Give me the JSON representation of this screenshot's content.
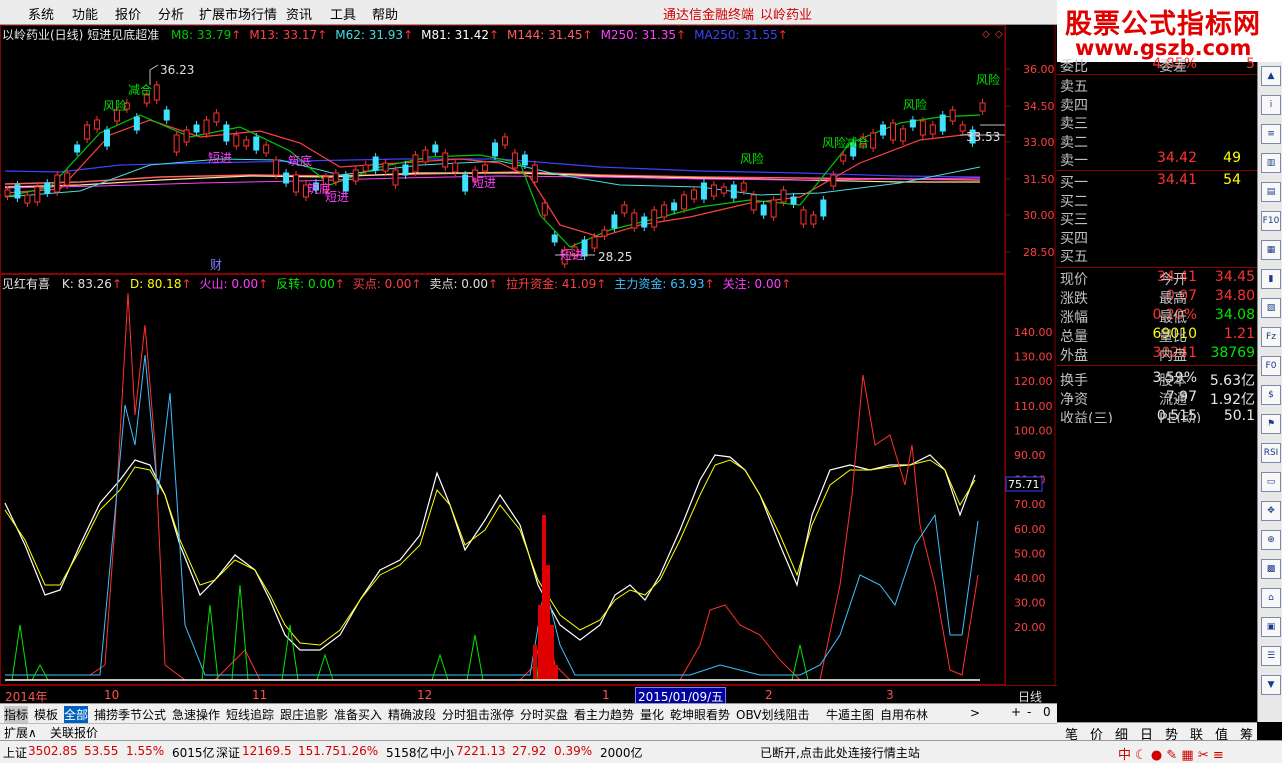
{
  "menu": {
    "items": [
      "系统",
      "功能",
      "报价",
      "分析",
      "扩展市场行情",
      "资讯",
      "工具",
      "帮助"
    ],
    "app_title": "通达信金融终端",
    "stock_title": "以岭药业"
  },
  "logo": {
    "line1": "股票公式指标网",
    "line2": "www.gszb.com"
  },
  "top_legend": {
    "title": "以岭药业(日线)",
    "formula": "短进见底超准",
    "items": [
      {
        "label": "M8: 33.79",
        "color": "#00c800"
      },
      {
        "label": "M13: 33.17",
        "color": "#ff4040"
      },
      {
        "label": "M62: 31.93",
        "color": "#40e0e0"
      },
      {
        "label": "M81: 31.42",
        "color": "#ffffff"
      },
      {
        "label": "M144: 31.45",
        "color": "#ff6060"
      },
      {
        "label": "M250: 31.35",
        "color": "#ff40ff"
      },
      {
        "label": "MA250: 31.55",
        "color": "#4040ff"
      }
    ]
  },
  "price_axis": [
    "36.00",
    "34.50",
    "33.00",
    "31.50",
    "30.00",
    "28.50"
  ],
  "price_annotations": {
    "high": "36.23",
    "low": "28.25",
    "last": "33.53"
  },
  "signals": {
    "risk": "风险",
    "jianhe": "减合",
    "short_entry": "短进",
    "fa": "财",
    "suanzhu": "筑底"
  },
  "bottom_legend": {
    "title": "见红有喜",
    "items": [
      {
        "label": "K: 83.26",
        "color": "#e0e0e0"
      },
      {
        "label": "D: 80.18",
        "color": "#ffff00"
      },
      {
        "label": "火山: 0.00",
        "color": "#ff40ff"
      },
      {
        "label": "反转: 0.00",
        "color": "#00e600"
      },
      {
        "label": "买点: 0.00",
        "color": "#ff4040"
      },
      {
        "label": "卖点: 0.00",
        "color": "#e0e0e0"
      },
      {
        "label": "拉升资金: 41.09",
        "color": "#ff4040"
      },
      {
        "label": "主力资金: 63.93",
        "color": "#40c0ff"
      },
      {
        "label": "关注: 0.00",
        "color": "#ff40ff"
      }
    ]
  },
  "ind_axis": [
    "140.00",
    "130.00",
    "120.00",
    "110.00",
    "100.00",
    "90.00",
    "80.00",
    "70.00",
    "60.00",
    "50.00",
    "40.00",
    "30.00",
    "20.00"
  ],
  "ind_current": "75.71",
  "date_axis": {
    "labels": [
      "2014年",
      "10",
      "11",
      "12",
      "1",
      "2",
      "3"
    ],
    "cursor": "2015/01/09/五",
    "period": "日线"
  },
  "quote": {
    "weibi": {
      "label": "委比",
      "value": "4.85%",
      "label2": "委差",
      "value2": "5"
    },
    "sell": [
      {
        "label": "卖五",
        "price": "",
        "vol": ""
      },
      {
        "label": "卖四",
        "price": "",
        "vol": ""
      },
      {
        "label": "卖三",
        "price": "",
        "vol": ""
      },
      {
        "label": "卖二",
        "price": "",
        "vol": ""
      },
      {
        "label": "卖一",
        "price": "34.42",
        "vol": "49"
      }
    ],
    "buy": [
      {
        "label": "买一",
        "price": "34.41",
        "vol": "54"
      },
      {
        "label": "买二",
        "price": "",
        "vol": ""
      },
      {
        "label": "买三",
        "price": "",
        "vol": ""
      },
      {
        "label": "买四",
        "price": "",
        "vol": ""
      },
      {
        "label": "买五",
        "price": "",
        "vol": ""
      }
    ],
    "stats": [
      {
        "l1": "现价",
        "v1": "34.41",
        "c1": "red",
        "l2": "今开",
        "v2": "34.45",
        "c2": "red"
      },
      {
        "l1": "涨跌",
        "v1": "0.07",
        "c1": "red",
        "l2": "最高",
        "v2": "34.80",
        "c2": "red"
      },
      {
        "l1": "涨幅",
        "v1": "0.20%",
        "c1": "red",
        "l2": "最低",
        "v2": "34.08",
        "c2": "green"
      },
      {
        "l1": "总量",
        "v1": "69010",
        "c1": "yellow",
        "l2": "量比",
        "v2": "1.21",
        "c2": "red"
      },
      {
        "l1": "外盘",
        "v1": "30241",
        "c1": "red",
        "l2": "内盘",
        "v2": "38769",
        "c2": "green"
      },
      {
        "l1": "换手",
        "v1": "3.59%",
        "c1": "white",
        "l2": "股本",
        "v2": "5.63亿",
        "c2": "white"
      },
      {
        "l1": "净资",
        "v1": "7.97",
        "c1": "white",
        "l2": "流通",
        "v2": "1.92亿",
        "c2": "white"
      },
      {
        "l1": "收益(三)",
        "v1": "0.515",
        "c1": "white",
        "l2": "PE(动)",
        "v2": "50.1",
        "c2": "white"
      }
    ]
  },
  "tabs": [
    "指标",
    "模板",
    "全部",
    "捕捞季节公式",
    "急速操作",
    "短线追踪",
    "跟庄追影",
    "准备买入",
    "精确波段",
    "分时狙击涨停",
    "分时买盘",
    "看主力趋势",
    "量化",
    "乾坤眼看势",
    "OBV划线阻击",
    "牛遁主图",
    "自用布林"
  ],
  "subtabs": [
    "扩展∧",
    "关联报价"
  ],
  "zoom": [
    "+",
    "-",
    "0"
  ],
  "right_tabs": [
    "笔",
    "价",
    "细",
    "日",
    "势",
    "联",
    "值",
    "筹"
  ],
  "status": {
    "sh_label": "上证",
    "sh_value": "3502.85",
    "sh_change": "53.55",
    "sh_pct": "1.55%",
    "sh_amount": "6015亿",
    "sz_label": "深证",
    "sz_value": "12169.5",
    "sz_change": "151.75",
    "sz_pct": "1.26%",
    "sz_amount": "5158亿",
    "zx_label": "中小",
    "zx_value": "7221.13",
    "zx_change": "27.92",
    "zx_pct": "0.39%",
    "zx_amount": "2000亿",
    "message": "已断开,点击此处连接行情主站"
  }
}
